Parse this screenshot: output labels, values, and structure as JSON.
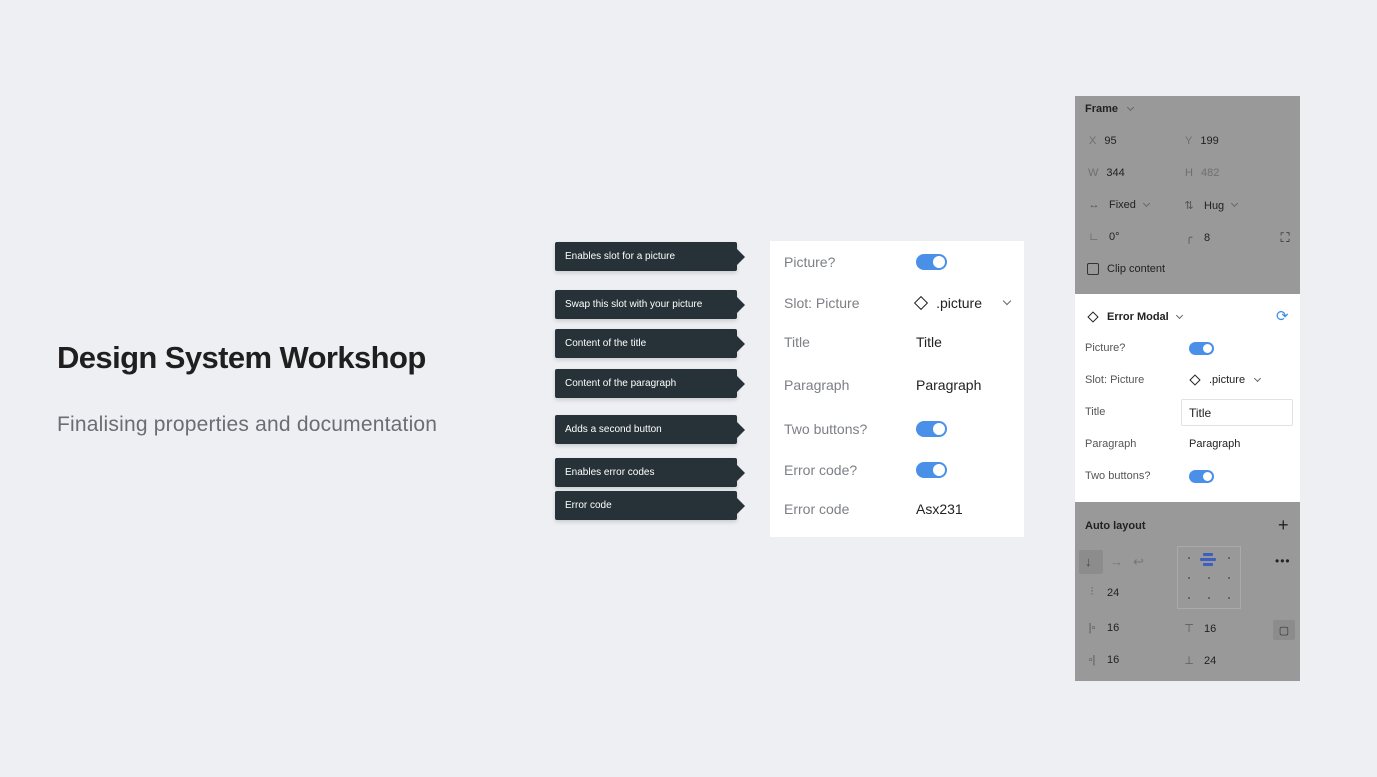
{
  "slide": {
    "title": "Design System Workshop",
    "subtitle": "Finalising properties and documentation"
  },
  "annotations": [
    "Enables slot for a picture",
    "Swap this slot with your picture",
    "Content of the title",
    "Content of the paragraph",
    "Adds a second button",
    "Enables error codes",
    "Error code"
  ],
  "properties": {
    "picture_label": "Picture?",
    "slot_label": "Slot: Picture",
    "slot_value": ".picture",
    "title_label": "Title",
    "title_value": "Title",
    "paragraph_label": "Paragraph",
    "paragraph_value": "Paragraph",
    "two_buttons_label": "Two buttons?",
    "error_code_toggle_label": "Error code?",
    "error_code_label": "Error code",
    "error_code_value": "Asx231"
  },
  "panel": {
    "frame": {
      "heading": "Frame",
      "x_label": "X",
      "x_value": "95",
      "y_label": "Y",
      "y_value": "199",
      "w_label": "W",
      "w_value": "344",
      "h_label": "H",
      "h_value": "482",
      "width_mode": "Fixed",
      "height_mode": "Hug",
      "rotation": "0°",
      "radius": "8",
      "clip_label": "Clip content"
    },
    "component": {
      "name": "Error Modal",
      "picture_label": "Picture?",
      "slot_label": "Slot: Picture",
      "slot_value": ".picture",
      "title_label": "Title",
      "title_value": "Title",
      "paragraph_label": "Paragraph",
      "paragraph_value": "Paragraph",
      "two_buttons_label": "Two buttons?"
    },
    "autolayout": {
      "heading": "Auto layout",
      "add_symbol": "+",
      "more_symbol": "•••",
      "spacing": "24",
      "pad_left": "16",
      "pad_top": "16",
      "pad_right": "16",
      "pad_bottom": "24"
    }
  },
  "colors": {
    "background": "#eeeff3",
    "tag": "#263238",
    "toggle": "#4a90e8",
    "panel_gray": "#999999",
    "accent_blue": "#3d5fbf"
  }
}
